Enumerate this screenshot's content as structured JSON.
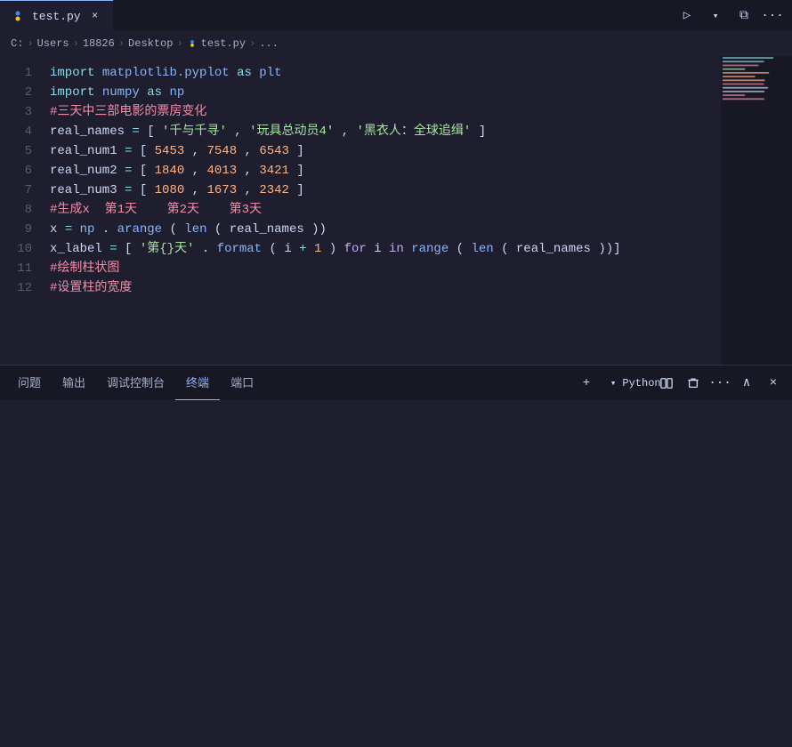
{
  "titlebar": {
    "tab_name": "test.py",
    "tab_close": "×",
    "btn_run": "▷",
    "btn_split": "⧉",
    "btn_more": "···"
  },
  "breadcrumb": {
    "parts": [
      "C:",
      "Users",
      "18826",
      "Desktop",
      "test.py",
      "..."
    ]
  },
  "code": {
    "lines": [
      {
        "num": "1",
        "content": "import_matplotlib"
      },
      {
        "num": "2",
        "content": "import_numpy"
      },
      {
        "num": "3",
        "content": "comment_title"
      },
      {
        "num": "4",
        "content": "real_names_assign"
      },
      {
        "num": "5",
        "content": "real_num1_assign"
      },
      {
        "num": "6",
        "content": "real_num2_assign"
      },
      {
        "num": "7",
        "content": "real_num3_assign"
      },
      {
        "num": "8",
        "content": "comment_x"
      },
      {
        "num": "9",
        "content": "x_assign"
      },
      {
        "num": "10",
        "content": "x_label_assign"
      },
      {
        "num": "11",
        "content": "comment_bar"
      },
      {
        "num": "12",
        "content": "comment_width"
      }
    ]
  },
  "panel": {
    "tabs": [
      "问题",
      "输出",
      "调试控制台",
      "终端",
      "端口"
    ],
    "active_tab": "终端",
    "python_label": "Python",
    "actions": {
      "add": "+",
      "dropdown": "▾",
      "split": "⧉",
      "trash": "🗑",
      "more": "···",
      "up": "∧",
      "close": "×"
    }
  }
}
